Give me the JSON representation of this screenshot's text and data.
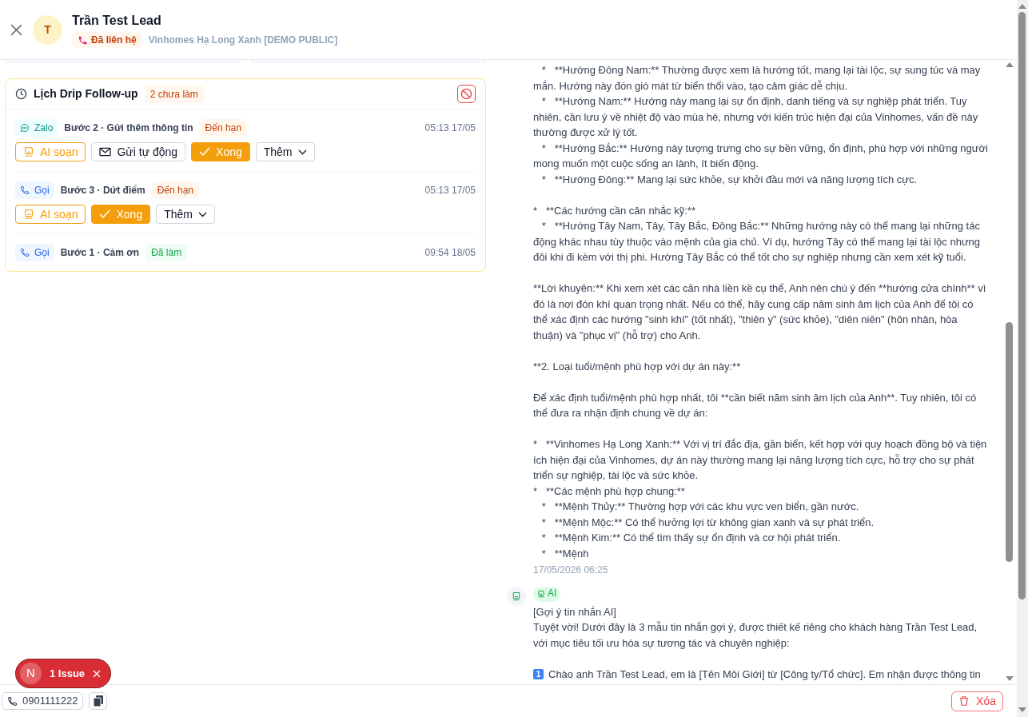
{
  "header": {
    "avatar": "T",
    "name": "Trần Test Lead",
    "status": "Đã liên hệ",
    "project": "Vinhomes Hạ Long Xanh [DEMO PUBLIC]"
  },
  "drip": {
    "title": "Lịch Drip Follow-up",
    "pending": "2 chưa làm",
    "steps": [
      {
        "channel": "Zalo",
        "kind": "zalo",
        "title": "Bước 2 · Gửi thêm thông tin",
        "status": "Đến hạn",
        "done": false,
        "time": "05:13 17/05",
        "actions": [
          {
            "kind": "ai",
            "label": "AI soạn"
          },
          {
            "kind": "send",
            "label": "Gửi tự động"
          },
          {
            "kind": "done",
            "label": "Xong"
          },
          {
            "kind": "more",
            "label": "Thêm"
          }
        ]
      },
      {
        "channel": "Gọi",
        "kind": "call",
        "title": "Bước 3 · Dứt điểm",
        "status": "Đến hạn",
        "done": false,
        "time": "05:13 17/05",
        "actions": [
          {
            "kind": "ai",
            "label": "AI soạn"
          },
          {
            "kind": "done",
            "label": "Xong"
          },
          {
            "kind": "more",
            "label": "Thêm"
          }
        ]
      },
      {
        "channel": "Gọi",
        "kind": "call",
        "title": "Bước 1 · Cảm ơn",
        "status": "Đã làm",
        "done": true,
        "time": "09:54 18/05"
      }
    ]
  },
  "messages": [
    {
      "kind": "text",
      "paragraphs": [
        {
          "text": "   *   **Hướng Đông Nam:** Thường được xem là hướng tốt, mang lại tài lộc, sự sung túc và may mắn. Hướng này đón gió mát từ biển thổi vào, tạo cảm giác dễ chịu.",
          "gap_before": false
        },
        {
          "text": "   *   **Hướng Nam:** Hướng này mang lại sự ổn định, danh tiếng và sự nghiệp phát triển. Tuy nhiên, cần lưu ý về nhiệt độ vào mùa hè, nhưng với kiến trúc hiện đại của Vinhomes, vấn đề này thường được xử lý tốt.",
          "gap_before": false
        },
        {
          "text": "   *   **Hướng Bắc:** Hướng này tượng trưng cho sự bền vững, ổn định, phù hợp với những người mong muốn một cuộc sống an lành, ít biến động.",
          "gap_before": false
        },
        {
          "text": "   *   **Hướng Đông:** Mang lại sức khỏe, sự khởi đầu mới và năng lượng tích cực.",
          "gap_before": false
        },
        {
          "text": "*   **Các hướng cần cân nhắc kỹ:**",
          "gap_before": true
        },
        {
          "text": "   *   **Hướng Tây Nam, Tây, Tây Bắc, Đông Bắc:** Những hướng này có thể mang lại những tác động khác nhau tùy thuộc vào mệnh của gia chủ. Ví dụ, hướng Tây có thể mang lại tài lộc nhưng đôi khi đi kèm với thị phi. Hướng Tây Bắc có thể tốt cho sự nghiệp nhưng cần xem xét kỹ tuổi.",
          "gap_before": false
        },
        {
          "text": "**Lời khuyên:** Khi xem xét các căn nhà liền kề cụ thể, Anh nên chú ý đến **hướng cửa chính** vì đó là nơi đón khí quan trọng nhất. Nếu có thể, hãy cung cấp năm sinh âm lịch của Anh để tôi có thể xác định các hướng \"sinh khí\" (tốt nhất), \"thiên y\" (sức khỏe), \"diên niên\" (hôn nhân, hòa thuận) và \"phục vị\" (hỗ trợ) cho Anh.",
          "gap_before": true
        },
        {
          "text": "**2. Loại tuổi/mệnh phù hợp với dự án này:**",
          "gap_before": true
        },
        {
          "text": "Để xác định tuổi/mệnh phù hợp nhất, tôi **cần biết năm sinh âm lịch của Anh**. Tuy nhiên, tôi có thể đưa ra nhận định chung về dự án:",
          "gap_before": true
        },
        {
          "text": "*   **Vinhomes Hạ Long Xanh:** Với vị trí đắc địa, gần biển, kết hợp với quy hoạch đồng bộ và tiện ích hiện đại của Vinhomes, dự án này thường mang lại năng lượng tích cực, hỗ trợ cho sự phát triển sự nghiệp, tài lộc và sức khỏe.",
          "gap_before": true
        },
        {
          "text": "*   **Các mệnh phù hợp chung:**",
          "gap_before": false
        },
        {
          "text": "   *   **Mệnh Thủy:** Thường hợp với các khu vực ven biển, gần nước.",
          "gap_before": false
        },
        {
          "text": "   *   **Mệnh Mộc:** Có thể hưởng lợi từ không gian xanh và sự phát triển.",
          "gap_before": false
        },
        {
          "text": "   *   **Mệnh Kim:** Có thể tìm thấy sự ổn định và cơ hội phát triển.",
          "gap_before": false
        },
        {
          "text": "   *   **Mệnh",
          "gap_before": false
        }
      ],
      "time": "17/05/2026 06:25"
    },
    {
      "kind": "ai",
      "badge": "AI",
      "paragraphs": [
        {
          "text": "[Gợi ý tin nhắn AI]",
          "gap_before": false
        },
        {
          "text": "Tuyệt vời! Dưới đây là 3 mẫu tin nhắn gợi ý, được thiết kế riêng cho khách hàng Trần Test Lead, với mục tiêu tối ưu hóa sự tương tác và chuyên nghiệp:",
          "gap_before": false
        },
        {
          "marker": "1",
          "text": "Chào anh Trần Test Lead, em là [Tên Môi Giới] từ [Công ty/Tổ chức]. Em nhận được thông tin",
          "gap_before": true
        }
      ]
    }
  ],
  "footer": {
    "phone": "0901111222",
    "delete": "Xóa"
  },
  "issue_badge": {
    "avatar": "N",
    "label": "1 Issue"
  }
}
